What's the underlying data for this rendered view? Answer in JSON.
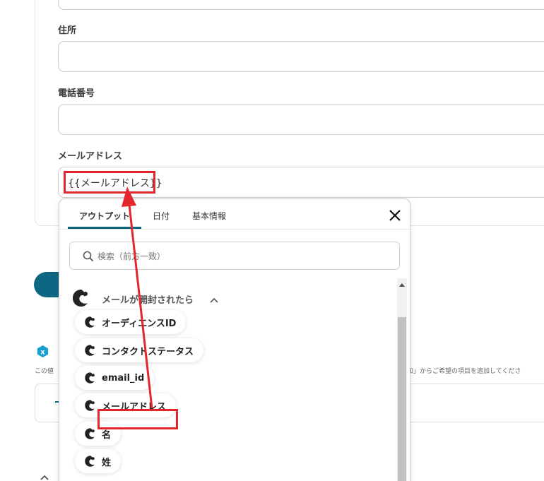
{
  "form": {
    "address_label": "住所",
    "phone_label": "電話番号",
    "email_label": "メールアドレス",
    "email_value": "{{メールアドレス}}"
  },
  "hint": {
    "left_text": "この値",
    "right_text": "加」からご希望の項目を追加してくださ"
  },
  "picker": {
    "tabs": [
      {
        "label": "アウトプット",
        "active": true
      },
      {
        "label": "日付",
        "active": false
      },
      {
        "label": "基本情報",
        "active": false
      }
    ],
    "search_placeholder": "検索（前方一致）",
    "group_title": "メールが開封されたら",
    "items": [
      {
        "label": "オーディエンスID"
      },
      {
        "label": "コンタクトステータス"
      },
      {
        "label": "email_id"
      },
      {
        "label": "メールアドレス"
      },
      {
        "label": "名"
      },
      {
        "label": "姓"
      }
    ]
  },
  "colors": {
    "accent": "#0e6782",
    "annotation_red": "#e3262b"
  },
  "icons": {
    "close": "close-icon",
    "search": "search-icon",
    "group_logo": "mailchimp-icon",
    "collapse": "chevron-up-icon"
  }
}
